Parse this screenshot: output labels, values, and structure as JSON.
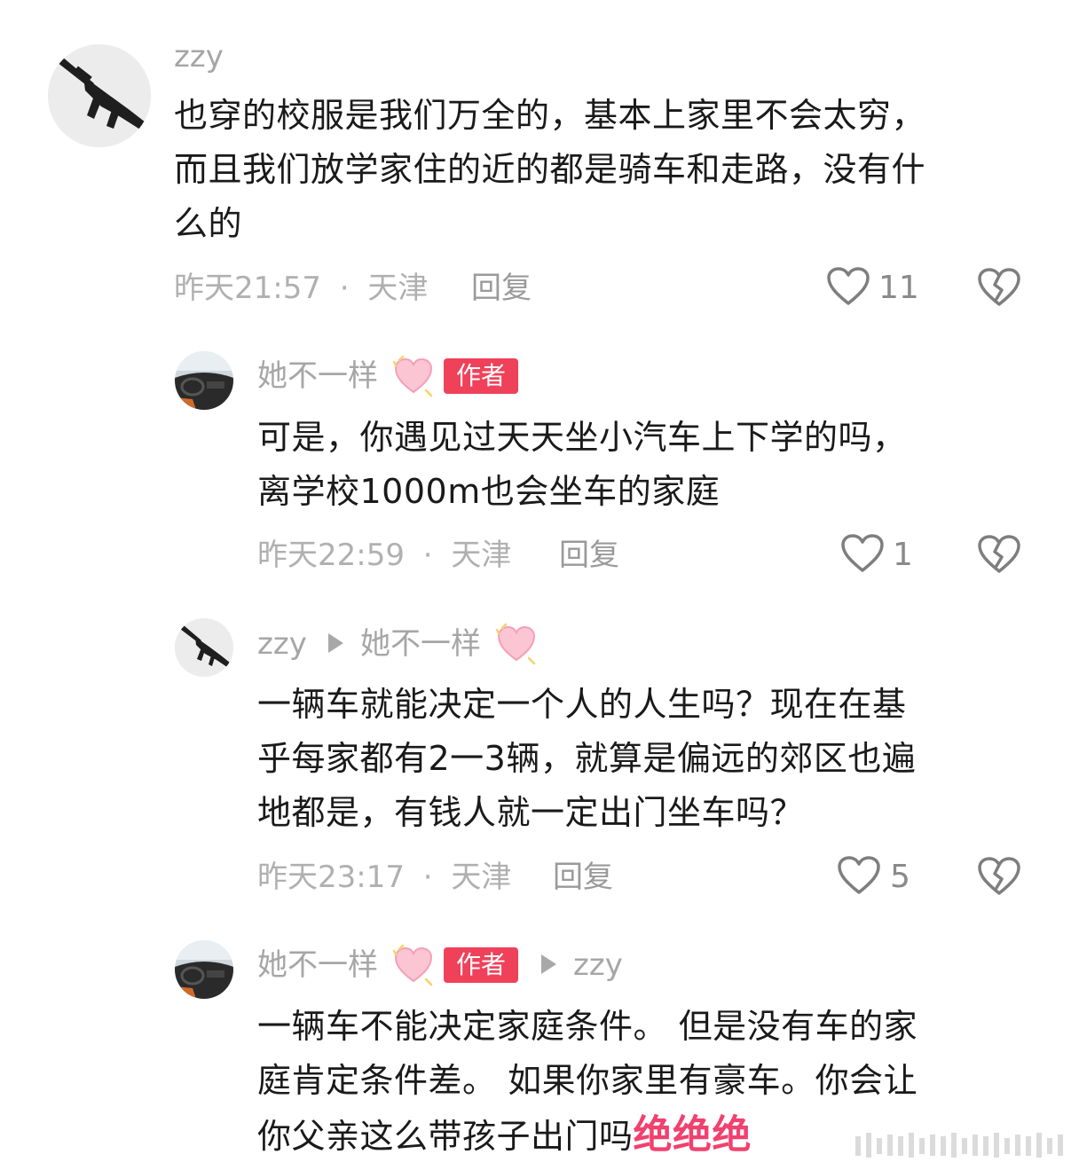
{
  "comments": [
    {
      "user": "zzy",
      "lines": [
        "也穿的校服是我们万全的，基本上家里不会太穷，",
        "而且我们放学家住的近的都是骑车和走路，没有什",
        "么的"
      ],
      "time": "昨天21:57",
      "location": "天津",
      "reply_label": "回复",
      "likes": "11"
    },
    {
      "user": "她不一样",
      "badge": "作者",
      "lines": [
        "可是，你遇见过天天坐小汽车上下学的吗，",
        "离学校1000m也会坐车的家庭"
      ],
      "time": "昨天22:59",
      "location": "天津",
      "reply_label": "回复",
      "likes": "1"
    },
    {
      "user": "zzy",
      "reply_to": "她不一样",
      "lines": [
        "一辆车就能决定一个人的人生吗？现在在基",
        "乎每家都有2一3辆，就算是偏远的郊区也遍",
        "地都是，有钱人就一定出门坐车吗？"
      ],
      "time": "昨天23:17",
      "location": "天津",
      "reply_label": "回复",
      "likes": "5"
    },
    {
      "user": "她不一样",
      "badge": "作者",
      "reply_to": "zzy",
      "lines": [
        "一辆车不能决定家庭条件。 但是没有车的家",
        "庭肯定条件差。   如果你家里有豪车。你会让"
      ],
      "last_line_prefix": "你父亲这么带孩子出门吗",
      "last_line_emphasis": "绝绝绝"
    }
  ],
  "separator": "·",
  "colors": {
    "badge": "#f0415a",
    "emphasis": "#f0416f",
    "meta": "#b0b0b0"
  },
  "icons": [
    "like-heart-icon",
    "dislike-broken-heart-icon",
    "pink-heart-emoji-icon",
    "reply-arrow-icon"
  ]
}
